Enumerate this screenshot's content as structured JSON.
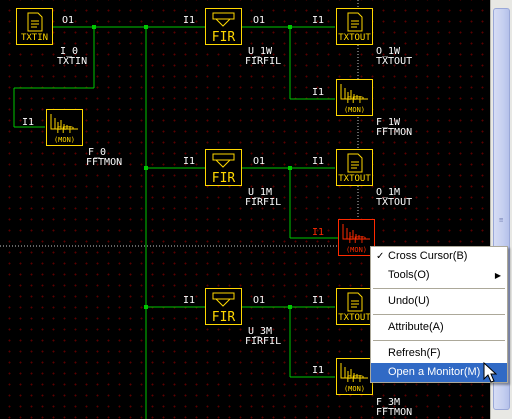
{
  "blocks": {
    "txtin": {
      "label": "TXTIN",
      "inst": "I_0",
      "type": "TXTIN",
      "out_port": "O1"
    },
    "fir_1w": {
      "label": "FIR",
      "inst": "U_1W",
      "type": "FIRFIL",
      "in_port": "I1",
      "out_port": "O1"
    },
    "txtout_1w": {
      "label": "TXTOUT",
      "inst": "O_1W",
      "type": "TXTOUT",
      "in_port": "I1"
    },
    "fft_1w": {
      "label": "FFT",
      "sub": "(MON)",
      "inst": "F_1W",
      "type": "FFTMON",
      "in_port": "I1"
    },
    "fft_0": {
      "label": "FFT",
      "sub": "(MON)",
      "inst": "F_0",
      "type": "FFTMON",
      "in_port": "I1"
    },
    "fir_1m": {
      "label": "FIR",
      "inst": "U_1M",
      "type": "FIRFIL",
      "in_port": "I1",
      "out_port": "O1"
    },
    "txtout_1m": {
      "label": "TXTOUT",
      "inst": "O_1M",
      "type": "TXTOUT",
      "in_port": "I1"
    },
    "fft_1m": {
      "label": "FFT",
      "sub": "(MON)",
      "in_port": "I1"
    },
    "fir_3m": {
      "label": "FIR",
      "inst": "U_3M",
      "type": "FIRFIL",
      "in_port": "I1",
      "out_port": "O1"
    },
    "txtout_3m": {
      "label": "TXTOUT",
      "in_port": "I1"
    },
    "fft_3m": {
      "label": "FFT",
      "sub": "(MON)",
      "inst": "F_3M",
      "type": "FFTMON",
      "in_port": "I1"
    }
  },
  "context_menu": {
    "items": [
      {
        "label": "Cross Cursor(B)",
        "checked": true
      },
      {
        "label": "Tools(O)",
        "submenu": true
      },
      {
        "label": "Undo(U)"
      },
      {
        "label": "Attribute(A)"
      },
      {
        "label": "Refresh(F)"
      },
      {
        "label": "Open a Monitor(M)",
        "highlighted": true
      }
    ],
    "check_glyph": "✓",
    "submenu_glyph": "▶"
  },
  "colors": {
    "wire": "#00c800",
    "block": "#ffd800",
    "selected_block": "#ff2a00",
    "grid_dot": "#5a0000",
    "menu_highlight": "#316ac5"
  }
}
